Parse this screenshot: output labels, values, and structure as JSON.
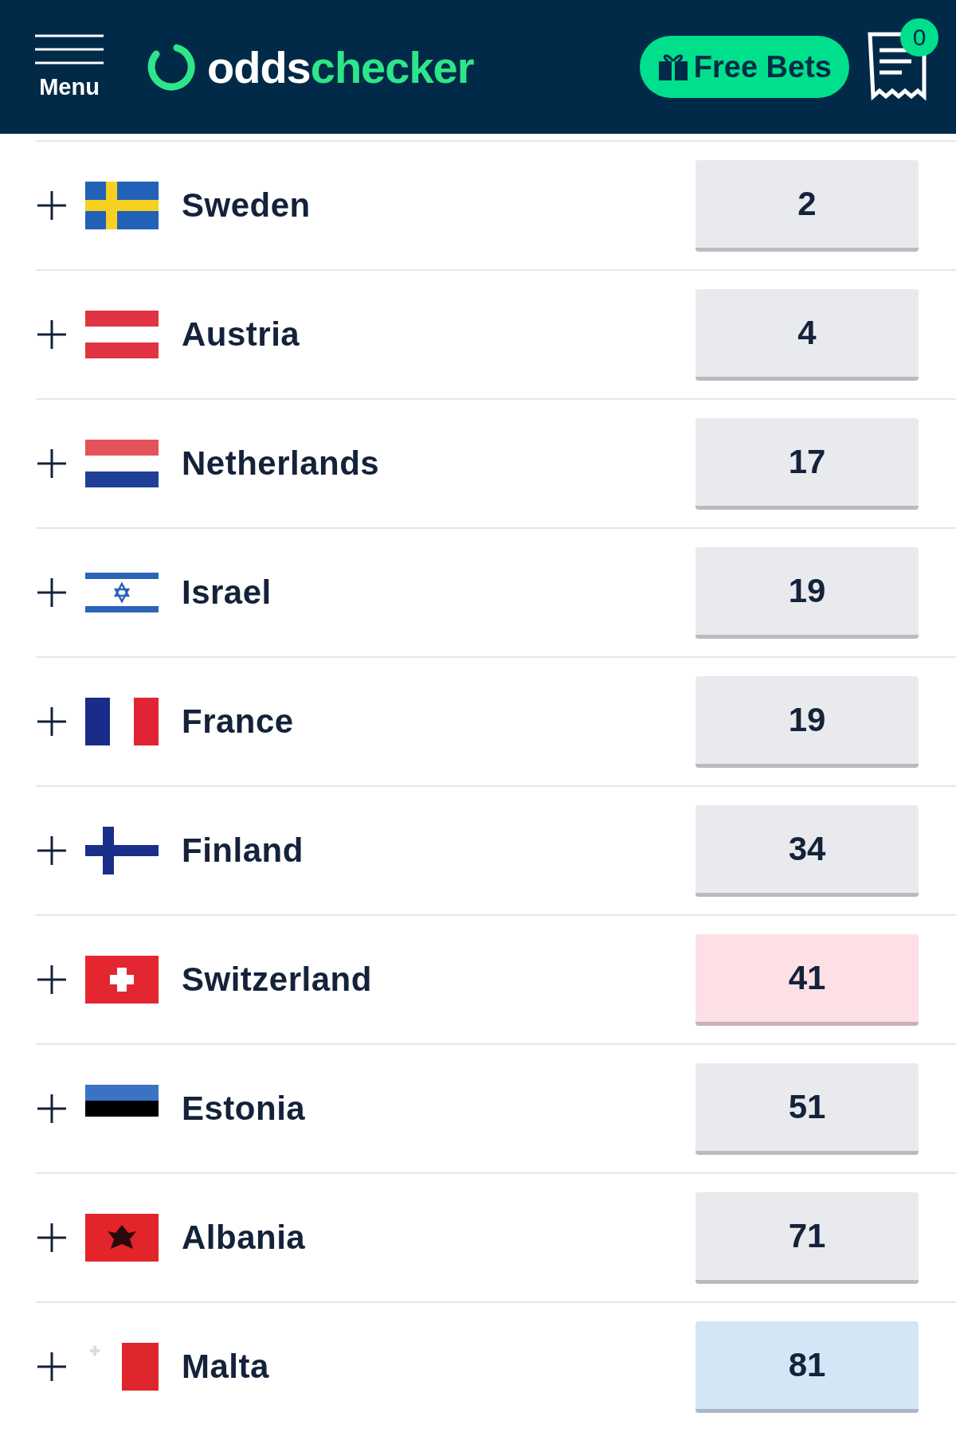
{
  "header": {
    "menu_label": "Menu",
    "logo": [
      "odds",
      "checker"
    ],
    "free_bets": "Free Bets",
    "betslip_count": "0"
  },
  "rows": [
    {
      "name": "Sweden",
      "kind": "se",
      "odds": "2",
      "color": "#e8eaed"
    },
    {
      "name": "Austria",
      "kind": "at",
      "odds": "4",
      "color": "#e8eaed"
    },
    {
      "name": "Netherlands",
      "kind": "nl",
      "odds": "17",
      "color": "#e8eaed"
    },
    {
      "name": "Israel",
      "kind": "il",
      "odds": "19",
      "color": "#e8eaed"
    },
    {
      "name": "France",
      "kind": "fr",
      "odds": "19",
      "color": "#e8eaed"
    },
    {
      "name": "Finland",
      "kind": "fi",
      "odds": "34",
      "color": "#e8eaed"
    },
    {
      "name": "Switzerland",
      "kind": "ch",
      "odds": "41",
      "color": "#fde0e5"
    },
    {
      "name": "Estonia",
      "kind": "ee",
      "odds": "51",
      "color": "#e8eaed"
    },
    {
      "name": "Albania",
      "kind": "al",
      "odds": "71",
      "color": "#e8eaed"
    },
    {
      "name": "Malta",
      "kind": "mt",
      "odds": "81",
      "color": "#d4e6f6"
    }
  ]
}
